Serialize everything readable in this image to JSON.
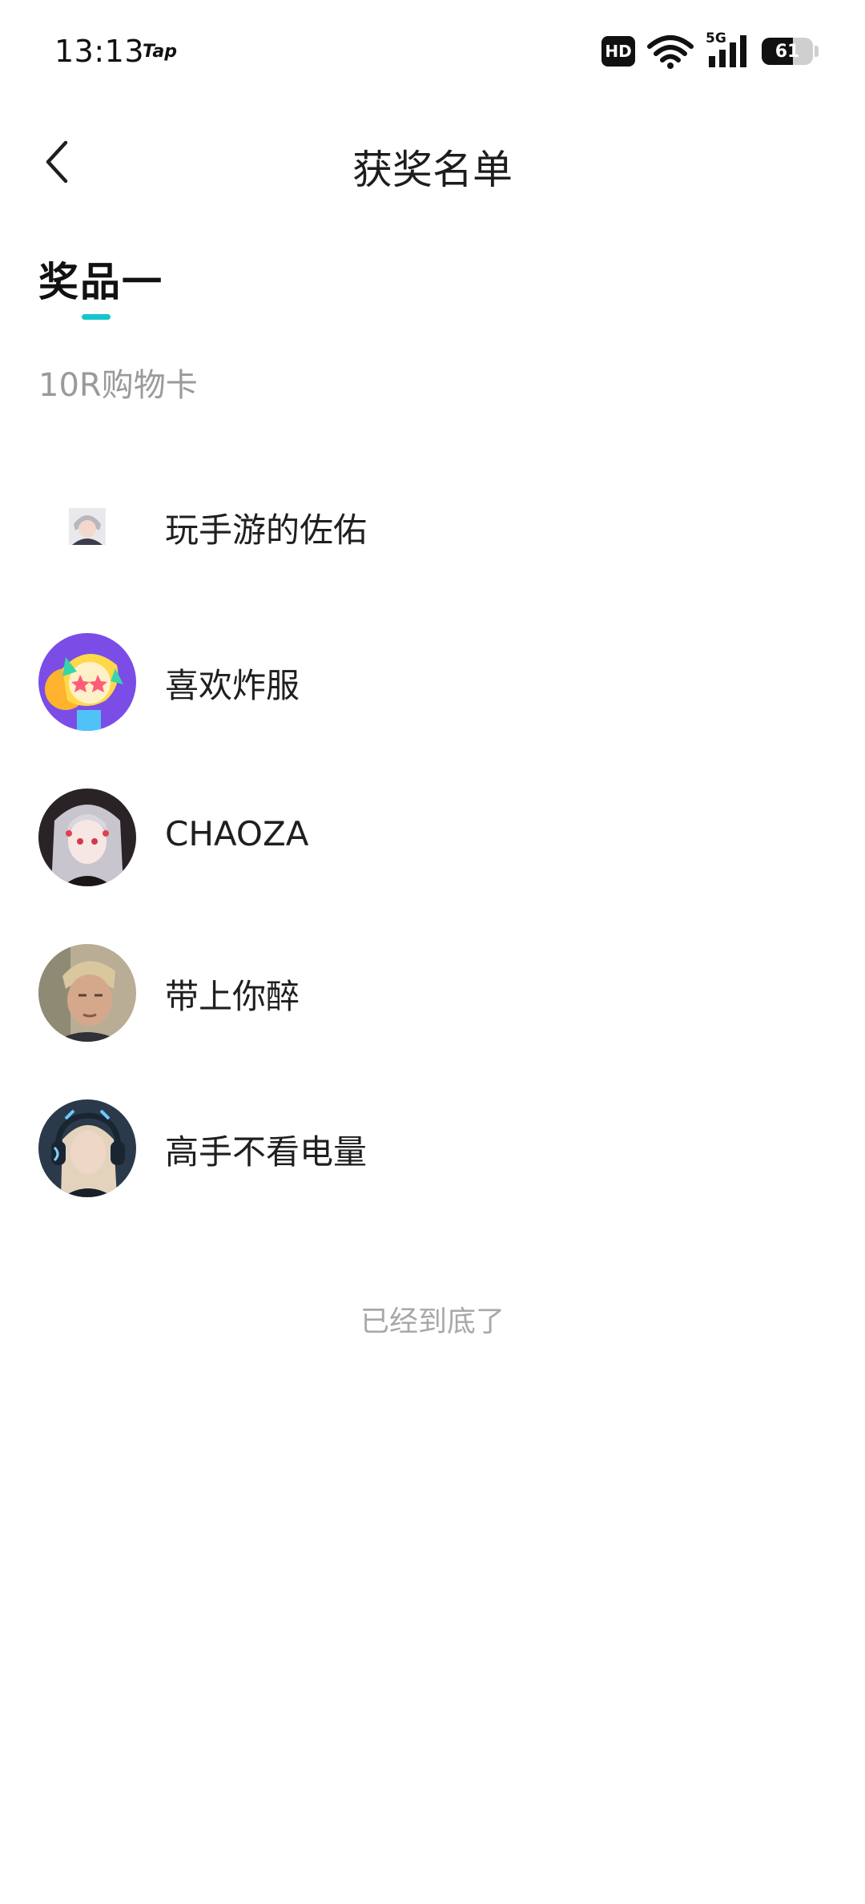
{
  "status_bar": {
    "time": "13:13",
    "app_label": "Tap",
    "hd_label": "HD",
    "network_label": "5G",
    "battery_percent": 61,
    "battery_text": "61"
  },
  "nav": {
    "title": "获奖名单"
  },
  "prize": {
    "tab_label": "奖品一",
    "name": "10R购物卡",
    "accent_color": "#15c5ce"
  },
  "winners": [
    {
      "name": "玩手游的佐佑",
      "avatar": "anime-boy-small-avatar"
    },
    {
      "name": "喜欢炸服",
      "avatar": "cartoon-star-avatar"
    },
    {
      "name": "CHAOZA",
      "avatar": "anime-girl-avatar"
    },
    {
      "name": "带上你醉",
      "avatar": "man-photo-avatar"
    },
    {
      "name": "高手不看电量",
      "avatar": "headphones-girl-avatar"
    }
  ],
  "footer": {
    "end_text": "已经到底了"
  }
}
